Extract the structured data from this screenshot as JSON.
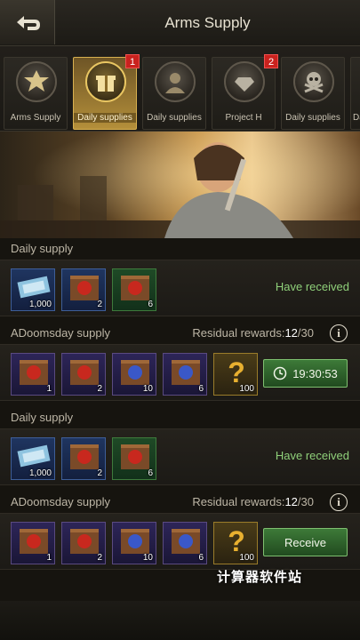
{
  "header": {
    "title": "Arms Supply"
  },
  "tabs": [
    {
      "label": "Arms Supply",
      "badge": ""
    },
    {
      "label": "Daily supplies",
      "badge": "1"
    },
    {
      "label": "Daily supplies",
      "badge": ""
    },
    {
      "label": "Project H",
      "badge": "2"
    },
    {
      "label": "Daily supplies",
      "badge": ""
    },
    {
      "label": "Da",
      "badge": ""
    }
  ],
  "sections": [
    {
      "label": "Daily supply",
      "residual_label": "",
      "residual_current": "",
      "residual_total": "",
      "items": [
        {
          "icon": "ticket-icon",
          "qty": "1,000"
        },
        {
          "icon": "red-crate-icon",
          "qty": "2"
        },
        {
          "icon": "red-crate-icon",
          "qty": "6"
        }
      ],
      "status": "Have received"
    },
    {
      "label": "ADoomsday supply",
      "residual_label": "Residual rewards:",
      "residual_current": "12",
      "residual_total": "/30",
      "items": [
        {
          "icon": "red-crate-icon",
          "qty": "1"
        },
        {
          "icon": "red-crate-icon",
          "qty": "2"
        },
        {
          "icon": "blue-crate-icon",
          "qty": "10"
        },
        {
          "icon": "blue-crate-icon",
          "qty": "6"
        },
        {
          "icon": "question-mark-icon",
          "qty": "100"
        }
      ],
      "timer": "19:30:53"
    },
    {
      "label": "Daily supply",
      "items": [
        {
          "icon": "ticket-icon",
          "qty": "1,000"
        },
        {
          "icon": "red-crate-icon",
          "qty": "2"
        },
        {
          "icon": "red-crate-icon",
          "qty": "6"
        }
      ],
      "status": "Have received"
    },
    {
      "label": "ADoomsday supply",
      "residual_label": "Residual rewards:",
      "residual_current": "12",
      "residual_total": "/30",
      "items": [
        {
          "icon": "red-crate-icon",
          "qty": "1"
        },
        {
          "icon": "red-crate-icon",
          "qty": "2"
        },
        {
          "icon": "blue-crate-icon",
          "qty": "10"
        },
        {
          "icon": "blue-crate-icon",
          "qty": "6"
        },
        {
          "icon": "question-mark-icon",
          "qty": "100"
        }
      ],
      "button": "Receive"
    }
  ],
  "watermark": "计算器软件站",
  "colors": {
    "accent_gold": "#d8b050",
    "status_green": "#8fd07a",
    "badge_red": "#c9221e"
  }
}
